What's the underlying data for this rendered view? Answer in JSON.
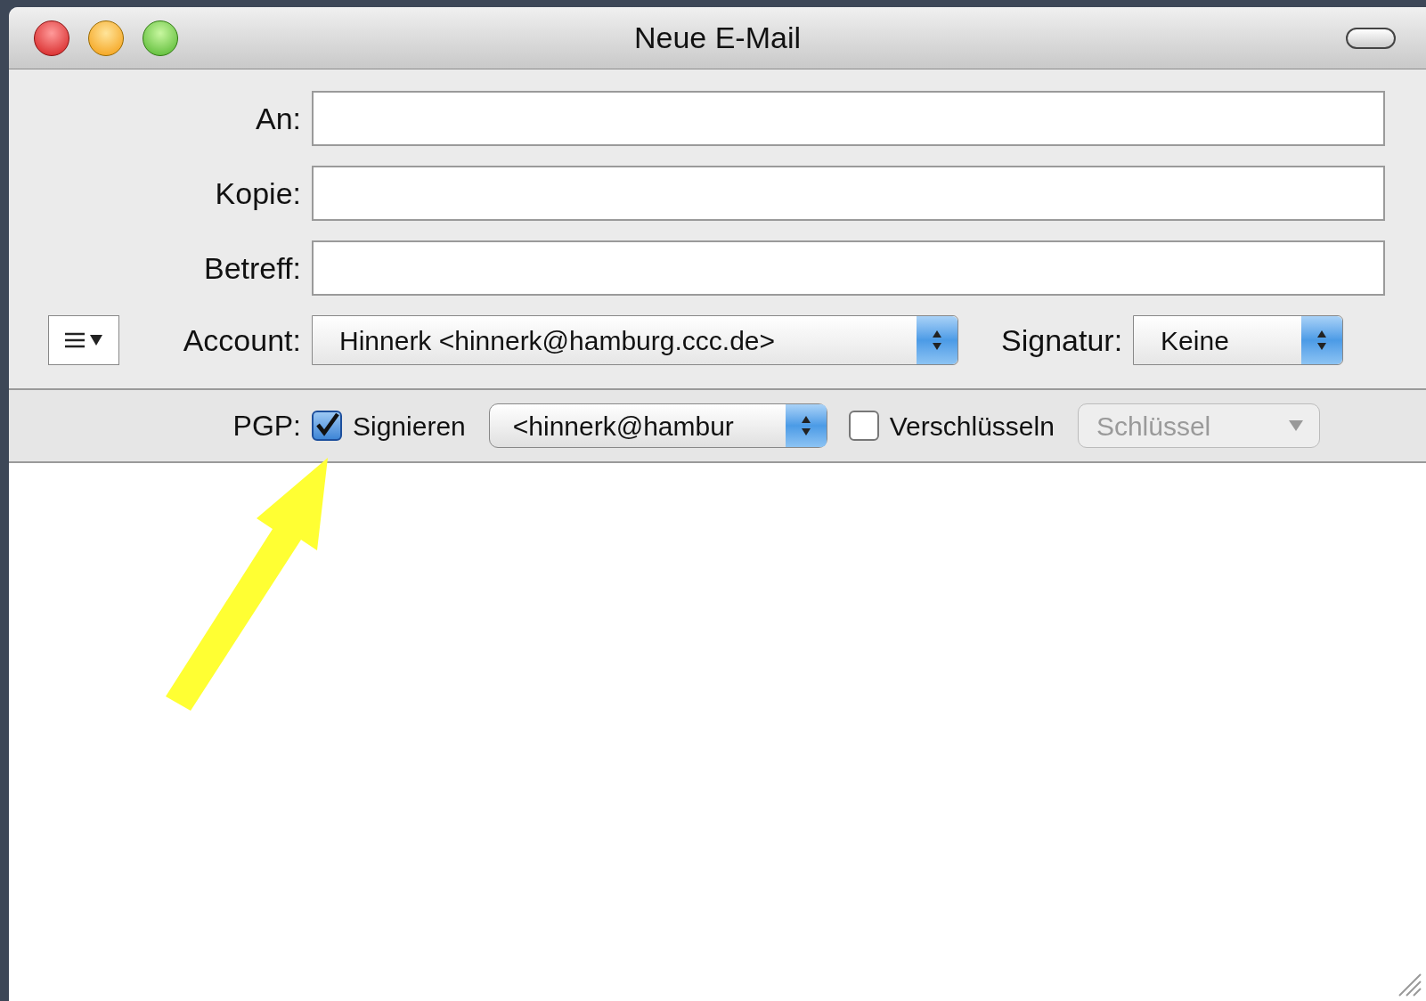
{
  "window": {
    "title": "Neue E-Mail"
  },
  "fields": [
    {
      "label": "An:"
    },
    {
      "label": "Kopie:"
    },
    {
      "label": "Betreff:"
    }
  ],
  "account": {
    "label": "Account:",
    "value": "Hinnerk <hinnerk@hamburg.ccc.de>"
  },
  "signature": {
    "label": "Signatur:",
    "value": "Keine"
  },
  "pgp": {
    "label": "PGP:",
    "sign": {
      "label": "Signieren",
      "checked": true
    },
    "sign_key": {
      "value": "<hinnerk@hambur"
    },
    "encrypt": {
      "label": "Verschlüsseln",
      "checked": false
    },
    "key": {
      "value": "Schlüssel",
      "disabled": true
    }
  }
}
